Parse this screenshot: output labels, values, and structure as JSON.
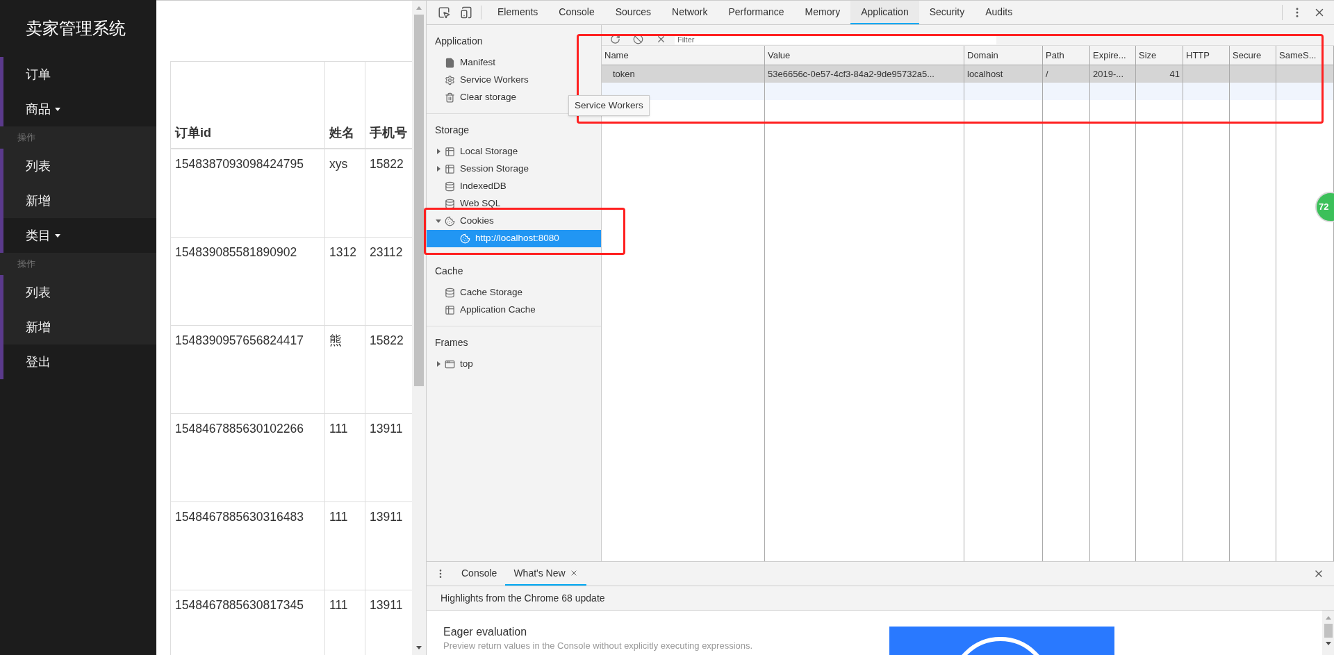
{
  "app": {
    "title": "卖家管理系统",
    "nav": [
      {
        "label": "订单",
        "kind": "link"
      },
      {
        "label": "商品",
        "kind": "dropdown"
      },
      {
        "label": "操作",
        "kind": "header"
      },
      {
        "label": "列表",
        "kind": "sublink"
      },
      {
        "label": "新增",
        "kind": "sublink"
      },
      {
        "label": "类目",
        "kind": "dropdown"
      },
      {
        "label": "操作",
        "kind": "header"
      },
      {
        "label": "列表",
        "kind": "sublink"
      },
      {
        "label": "新增",
        "kind": "sublink"
      },
      {
        "label": "登出",
        "kind": "link"
      }
    ],
    "table": {
      "columns": [
        "订单id",
        "姓名",
        "手机号"
      ],
      "rows": [
        [
          "1548387093098424795",
          "xys",
          "15822"
        ],
        [
          "154839085581890902",
          "1312",
          "23112"
        ],
        [
          "1548390957656824417",
          "熊",
          "15822"
        ],
        [
          "1548467885630102266",
          "111",
          "13911"
        ],
        [
          "1548467885630316483",
          "111",
          "13911"
        ],
        [
          "1548467885630817345",
          "111",
          "13911"
        ]
      ]
    }
  },
  "devtools": {
    "tabs": [
      {
        "label": "Elements",
        "selected": false
      },
      {
        "label": "Console",
        "selected": false
      },
      {
        "label": "Sources",
        "selected": false
      },
      {
        "label": "Network",
        "selected": false
      },
      {
        "label": "Performance",
        "selected": false
      },
      {
        "label": "Memory",
        "selected": false
      },
      {
        "label": "Application",
        "selected": true
      },
      {
        "label": "Security",
        "selected": false
      },
      {
        "label": "Audits",
        "selected": false
      }
    ],
    "sidebar": [
      {
        "title": "Application",
        "items": [
          {
            "label": "Manifest",
            "kind": "file",
            "selected": false
          },
          {
            "label": "Service Workers",
            "kind": "gear",
            "selected": false
          },
          {
            "label": "Clear storage",
            "kind": "trash",
            "selected": false
          }
        ]
      },
      {
        "title": "Storage",
        "items": [
          {
            "label": "Local Storage",
            "kind": "grid",
            "expanded": false,
            "selected": false
          },
          {
            "label": "Session Storage",
            "kind": "grid",
            "expanded": false,
            "selected": false
          },
          {
            "label": "IndexedDB",
            "kind": "database",
            "selected": false
          },
          {
            "label": "Web SQL",
            "kind": "database",
            "selected": false
          },
          {
            "label": "Cookies",
            "kind": "cookie",
            "expanded": true,
            "selected": false,
            "children": [
              {
                "label": "http://localhost:8080",
                "kind": "cookie",
                "selected": true
              }
            ]
          }
        ]
      },
      {
        "title": "Cache",
        "items": [
          {
            "label": "Cache Storage",
            "kind": "database",
            "selected": false
          },
          {
            "label": "Application Cache",
            "kind": "grid",
            "selected": false
          }
        ]
      },
      {
        "title": "Frames",
        "items": [
          {
            "label": "top",
            "kind": "frame",
            "expanded": false,
            "selected": false
          }
        ]
      }
    ],
    "filter": {
      "placeholder": "Filter"
    },
    "cookies": {
      "columns": [
        {
          "label": "Name",
          "kind": "text"
        },
        {
          "label": "Value",
          "kind": "text"
        },
        {
          "label": "Domain",
          "kind": "text"
        },
        {
          "label": "Path",
          "kind": "text"
        },
        {
          "label": "Expire...",
          "kind": "text"
        },
        {
          "label": "Size",
          "kind": "number"
        },
        {
          "label": "HTTP",
          "kind": "text"
        },
        {
          "label": "Secure",
          "kind": "text"
        },
        {
          "label": "SameS...",
          "kind": "text"
        }
      ],
      "rows": [
        {
          "cells": [
            "token",
            "53e6656c-0e57-4cf3-84a2-9de95732a5...",
            "localhost",
            "/",
            "2019-...",
            "41",
            "",
            "",
            ""
          ],
          "selected": true
        }
      ]
    },
    "tooltip": "Service Workers",
    "drawer": {
      "tabs": [
        {
          "label": "Console",
          "selected": false,
          "closable": false
        },
        {
          "label": "What's New",
          "selected": true,
          "closable": true
        }
      ],
      "banner": "Highlights from the Chrome 68 update",
      "heading": "Eager evaluation",
      "description": "Preview return values in the Console without explicitly executing expressions."
    }
  },
  "floating_badge": {
    "text": "72"
  }
}
